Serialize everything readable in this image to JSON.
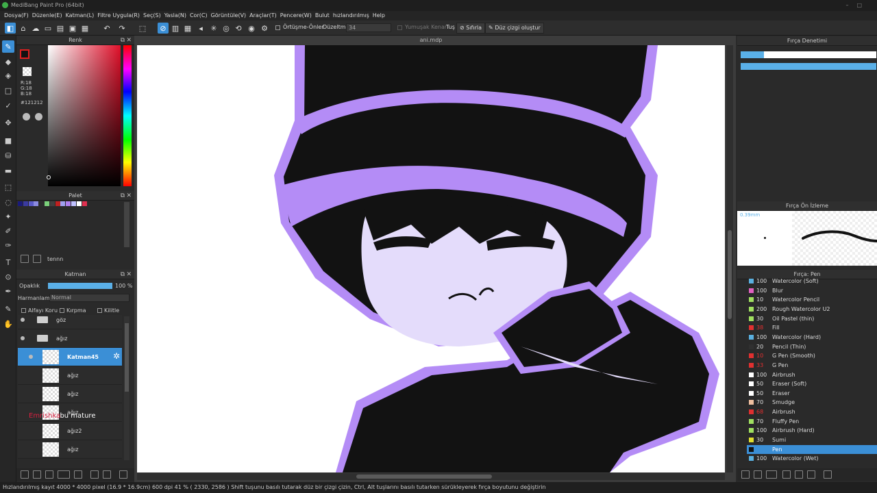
{
  "app": {
    "title": "MediBang Paint Pro (64bit)"
  },
  "menu": [
    "Dosya(F)",
    "Düzenle(E)",
    "Katman(L)",
    "Filtre Uygula(R)",
    "Seç(S)",
    "Yasla(N)",
    "Cor(C)",
    "Görüntüle(V)",
    "Araçlar(T)",
    "Pencere(W)",
    "Bulut",
    "hızlandırılmış",
    "Help"
  ],
  "toolbar": {
    "antialias_label": "Örtüşme-Önler",
    "correction_label": "Düzeltme",
    "correction_value": "34",
    "soft_edge_label": "Yumuşak Kenar",
    "tug_label": "Tuş",
    "reset_label": "Sıfırla",
    "straight_line_label": "Düz çizgi oluştur"
  },
  "color_panel": {
    "title": "Renk",
    "r": "R:18",
    "g": "G:18",
    "b": "B:18",
    "hex": "#121212"
  },
  "palette_panel": {
    "title": "Palet",
    "palette_name": "tennn",
    "swatches": [
      "#1a1a7a",
      "#3a3aa0",
      "#5a5ac8",
      "#8a8ae0",
      "#2c2c2c",
      "#7ad07a",
      "#404040",
      "#c02020",
      "#a0a0f0",
      "#b080f0",
      "#c0c0ff",
      "#ffffff",
      "#e03050"
    ]
  },
  "layer_panel": {
    "title": "Katman",
    "opacity_label": "Opaklık",
    "opacity_value": "100 %",
    "opacity_fraction": 1.0,
    "blend_label": "Harmanlama",
    "blend_value": "Normal",
    "alpha_protect": "Alfayı Koru",
    "clipping": "Kırpma",
    "lock": "Kilitle",
    "layers": [
      {
        "name": "göz",
        "type": "folder"
      },
      {
        "name": "ağız",
        "type": "folder"
      },
      {
        "name": "Katman45",
        "type": "layer",
        "selected": true
      },
      {
        "name": "ağız",
        "type": "layer"
      },
      {
        "name": "ağız",
        "type": "layer"
      },
      {
        "name": "ağız",
        "type": "layer"
      },
      {
        "name": "ağız2",
        "type": "layer"
      },
      {
        "name": "ağız",
        "type": "layer"
      }
    ],
    "overlay_text_red": "Emrishka",
    "overlay_text_white": "bu mature"
  },
  "canvas": {
    "tab_title": "ani.mdp"
  },
  "right_panel": {
    "brush_control_title": "Fırça Denetimi",
    "brush_preview_title": "Fırça Ön İzleme",
    "brush_preview_size": "0.39mm",
    "brush_list_title": "Fırça: Pen",
    "brushes": [
      {
        "size": "100",
        "name": "Watercolor (Soft)",
        "color": "#5ab0e0"
      },
      {
        "size": "100",
        "name": "Blur",
        "color": "#e060c0"
      },
      {
        "size": "10",
        "name": "Watercolor Pencil",
        "color": "#a0e060"
      },
      {
        "size": "200",
        "name": "Rough Watercolor U2",
        "color": "#a0e060"
      },
      {
        "size": "30",
        "name": "Oil Pastel (thin)",
        "color": "#a0e060"
      },
      {
        "size": "38",
        "name": "Fill",
        "color": "#e03030"
      },
      {
        "size": "100",
        "name": "Watercolor (Hard)",
        "color": "#5ab0e0"
      },
      {
        "size": "20",
        "name": "Pencil (Thin)",
        "color": "#303030"
      },
      {
        "size": "10",
        "name": "G Pen (Smooth)",
        "color": "#e03030"
      },
      {
        "size": "33",
        "name": "G Pen",
        "color": "#e03030"
      },
      {
        "size": "100",
        "name": "Airbrush",
        "color": "#ffffff"
      },
      {
        "size": "50",
        "name": "Eraser (Soft)",
        "color": "#ffffff"
      },
      {
        "size": "50",
        "name": "Eraser",
        "color": "#ffffff"
      },
      {
        "size": "70",
        "name": "Smudge",
        "color": "#f0c0a0"
      },
      {
        "size": "68",
        "name": "Airbrush",
        "color": "#e03030"
      },
      {
        "size": "70",
        "name": "Fluffy Pen",
        "color": "#a0e060"
      },
      {
        "size": "100",
        "name": "Airbrush (Hard)",
        "color": "#a0e060"
      },
      {
        "size": "30",
        "name": "Sumi",
        "color": "#e0e030"
      },
      {
        "size": "",
        "name": "Pen",
        "color": "#121212",
        "selected": true
      },
      {
        "size": "100",
        "name": "Watercolor (Wet)",
        "color": "#5ab0e0"
      }
    ]
  },
  "status": {
    "text": "Hızlandırılmış kayıt   4000 * 4000 pixel   (16.9 * 16.9cm)   600 dpi   41 %   ( 2330, 2586 )   Shift tuşunu basılı tutarak düz bir çizgi çizin, Ctrl, Alt tuşlarını basılı tutarken sürükleyerek fırça boyutunu değiştirin"
  },
  "colors": {
    "accent": "#3b8fd6",
    "outline": "#b48cf6",
    "skin": "#e4dcfb",
    "ink": "#121212"
  }
}
